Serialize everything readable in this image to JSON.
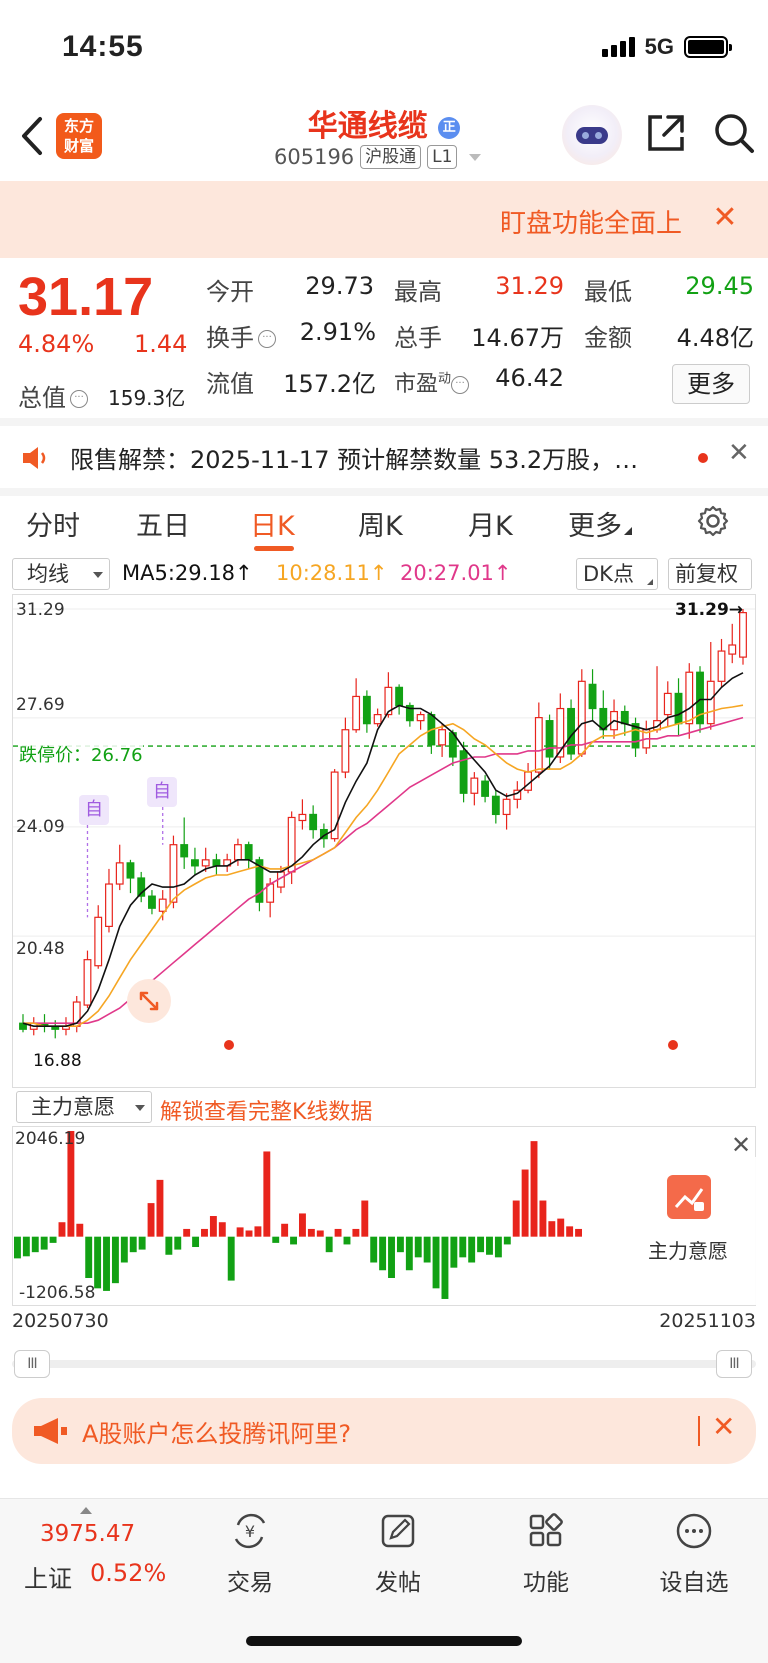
{
  "status_bar": {
    "time": "14:55",
    "network": "5G"
  },
  "nav": {
    "logo_text": "东方财富",
    "stock_name": "华通线缆",
    "stock_code": "605196",
    "tag_connect": "沪股通",
    "tag_level": "L1"
  },
  "banner": {
    "text": "盯盘功能全面上",
    "close": "✕"
  },
  "quote": {
    "price": "31.17",
    "change_pct": "4.84%",
    "change": "1.44",
    "market_cap_label": "总值",
    "market_cap_value": "159.3亿",
    "open_label": "今开",
    "open": "29.73",
    "high_label": "最高",
    "high": "31.29",
    "low_label": "最低",
    "low": "29.45",
    "turnover_label": "换手",
    "turnover": "2.91%",
    "volume_label": "总手",
    "volume": "14.67万",
    "amount_label": "金额",
    "amount": "4.48亿",
    "float_cap_label": "流值",
    "float_cap": "157.2亿",
    "pe_label": "市盈",
    "pe_sup": "动",
    "pe": "46.42",
    "more_label": "更多"
  },
  "notice": {
    "text": "限售解禁：2025-11-17 预计解禁数量 53.2万股，…"
  },
  "tabs": [
    "分时",
    "五日",
    "日K",
    "周K",
    "月K",
    "更多"
  ],
  "active_tab": "日K",
  "ma_row": {
    "dropdown": "均线",
    "ma5": "MA5:29.18↑",
    "ma10": "10:28.11↑",
    "ma20": "20:27.01↑",
    "dk_button": "DK点",
    "adjust_button": "前复权"
  },
  "colors": {
    "up": "#e8241c",
    "down": "#12a114",
    "ma5": "#111111",
    "ma10": "#f6a623",
    "ma20": "#e0388a",
    "accent": "#f05a24"
  },
  "chart_data": [
    {
      "type": "candlestick",
      "y_ticks": [
        "31.29",
        "27.69",
        "24.09",
        "20.48"
      ],
      "ylim": [
        16.88,
        31.29
      ],
      "limit_down_label": "跌停价：",
      "limit_down_value": "26.76",
      "high_marker": "31.29→",
      "low_marker": "16.88",
      "event_markers": [
        "自",
        "自"
      ],
      "candles": [
        [
          17.6,
          17.4,
          17.9,
          17.3
        ],
        [
          17.4,
          17.6,
          17.8,
          17.2
        ],
        [
          17.6,
          17.5,
          17.9,
          17.3
        ],
        [
          17.5,
          17.4,
          17.7,
          17.1
        ],
        [
          17.4,
          17.5,
          17.8,
          17.2
        ],
        [
          17.5,
          18.3,
          18.5,
          17.3
        ],
        [
          18.2,
          19.7,
          20.0,
          18.1
        ],
        [
          19.5,
          21.1,
          21.5,
          19.4
        ],
        [
          20.8,
          22.2,
          22.7,
          20.6
        ],
        [
          22.2,
          22.9,
          23.5,
          22.0
        ],
        [
          22.9,
          22.4,
          23.0,
          21.9
        ],
        [
          22.4,
          21.8,
          22.6,
          21.6
        ],
        [
          21.8,
          21.4,
          22.0,
          21.2
        ],
        [
          21.3,
          21.7,
          22.0,
          21.0
        ],
        [
          21.6,
          23.5,
          23.8,
          21.4
        ],
        [
          23.5,
          23.1,
          24.4,
          22.7
        ],
        [
          23.0,
          22.8,
          23.4,
          22.5
        ],
        [
          22.8,
          23.0,
          23.4,
          22.6
        ],
        [
          23.0,
          22.8,
          23.2,
          22.5
        ],
        [
          22.8,
          23.0,
          23.2,
          22.6
        ],
        [
          23.0,
          23.5,
          23.7,
          22.8
        ],
        [
          23.5,
          23.0,
          23.6,
          22.7
        ],
        [
          23.0,
          21.6,
          23.1,
          21.3
        ],
        [
          21.6,
          22.2,
          22.4,
          21.1
        ],
        [
          22.1,
          22.6,
          22.8,
          21.9
        ],
        [
          22.6,
          24.4,
          24.6,
          22.2
        ],
        [
          24.3,
          24.5,
          25.0,
          24.0
        ],
        [
          24.5,
          24.0,
          24.8,
          23.7
        ],
        [
          24.0,
          23.7,
          24.2,
          23.4
        ],
        [
          23.7,
          25.9,
          26.0,
          23.6
        ],
        [
          25.9,
          27.3,
          27.7,
          25.7
        ],
        [
          27.3,
          28.4,
          29.0,
          27.2
        ],
        [
          28.4,
          27.5,
          28.6,
          27.2
        ],
        [
          27.5,
          27.8,
          28.0,
          27.4
        ],
        [
          27.8,
          28.7,
          29.2,
          27.7
        ],
        [
          28.7,
          28.1,
          28.8,
          27.8
        ],
        [
          28.1,
          27.6,
          28.2,
          27.4
        ],
        [
          27.6,
          27.8,
          27.9,
          27.3
        ],
        [
          27.8,
          26.8,
          27.9,
          26.5
        ],
        [
          26.8,
          27.3,
          27.5,
          26.4
        ],
        [
          27.2,
          26.4,
          27.3,
          26.1
        ],
        [
          26.6,
          25.2,
          26.9,
          24.9
        ],
        [
          25.2,
          25.7,
          25.9,
          24.8
        ],
        [
          25.6,
          25.1,
          25.8,
          24.9
        ],
        [
          25.1,
          24.5,
          25.3,
          24.2
        ],
        [
          24.5,
          25.0,
          25.2,
          24.0
        ],
        [
          25.0,
          25.3,
          25.6,
          24.7
        ],
        [
          25.3,
          25.9,
          26.2,
          25.2
        ],
        [
          25.9,
          27.7,
          28.2,
          25.7
        ],
        [
          27.6,
          26.4,
          27.8,
          26.0
        ],
        [
          26.4,
          28.0,
          28.5,
          26.2
        ],
        [
          28.0,
          26.5,
          28.3,
          26.3
        ],
        [
          26.5,
          28.9,
          29.3,
          26.4
        ],
        [
          28.8,
          28.0,
          29.3,
          27.6
        ],
        [
          28.0,
          27.3,
          28.6,
          27.0
        ],
        [
          27.3,
          27.9,
          28.3,
          27.0
        ],
        [
          27.9,
          27.5,
          28.1,
          27.1
        ],
        [
          27.5,
          26.7,
          27.7,
          26.4
        ],
        [
          26.7,
          27.3,
          27.6,
          26.5
        ],
        [
          27.3,
          27.6,
          29.4,
          27.2
        ],
        [
          27.8,
          28.5,
          28.9,
          27.4
        ],
        [
          28.5,
          27.5,
          29.0,
          27.1
        ],
        [
          27.5,
          29.2,
          29.5,
          27.0
        ],
        [
          29.2,
          27.5,
          29.4,
          27.2
        ],
        [
          27.5,
          28.9,
          30.2,
          27.3
        ],
        [
          28.9,
          29.9,
          30.3,
          28.7
        ],
        [
          29.8,
          30.1,
          30.8,
          29.5
        ],
        [
          29.7,
          31.17,
          31.29,
          29.45
        ]
      ],
      "ma5": [
        17.6,
        17.5,
        17.5,
        17.5,
        17.5,
        17.6,
        18.0,
        18.7,
        19.7,
        20.8,
        21.5,
        21.9,
        22.2,
        22.1,
        22.1,
        22.2,
        22.5,
        22.7,
        22.8,
        22.8,
        23.0,
        23.0,
        22.8,
        22.6,
        22.6,
        22.8,
        23.1,
        23.5,
        23.8,
        24.0,
        24.9,
        25.6,
        26.2,
        27.3,
        27.9,
        28.1,
        28.0,
        28.0,
        27.8,
        27.5,
        27.2,
        26.7,
        26.3,
        25.9,
        25.3,
        25.1,
        25.2,
        25.5,
        25.8,
        26.1,
        26.6,
        27.1,
        27.5,
        27.6,
        27.3,
        27.6,
        27.5,
        27.4,
        27.3,
        27.4,
        27.7,
        27.8,
        28.0,
        28.3,
        28.3,
        28.7,
        29.0,
        29.18
      ],
      "ma10": [
        17.6,
        17.6,
        17.5,
        17.5,
        17.5,
        17.5,
        17.7,
        18.0,
        18.5,
        19.1,
        19.7,
        20.2,
        20.7,
        21.2,
        21.7,
        22.0,
        22.2,
        22.4,
        22.5,
        22.5,
        22.6,
        22.7,
        22.8,
        22.7,
        22.7,
        22.8,
        22.9,
        23.0,
        23.2,
        23.4,
        23.9,
        24.4,
        24.8,
        25.3,
        25.9,
        26.5,
        26.8,
        27.1,
        27.3,
        27.4,
        27.5,
        27.3,
        27.0,
        26.8,
        26.5,
        26.2,
        26.0,
        25.9,
        26.0,
        26.0,
        26.0,
        26.2,
        26.5,
        26.9,
        27.1,
        27.1,
        27.2,
        27.3,
        27.2,
        27.3,
        27.4,
        27.5,
        27.6,
        27.8,
        27.9,
        28.0,
        28.05,
        28.11
      ],
      "ma20": [
        17.6,
        17.6,
        17.6,
        17.6,
        17.6,
        17.6,
        17.6,
        17.7,
        17.9,
        18.1,
        18.4,
        18.7,
        19.0,
        19.3,
        19.6,
        19.9,
        20.2,
        20.5,
        20.8,
        21.1,
        21.4,
        21.7,
        21.9,
        22.2,
        22.4,
        22.6,
        22.8,
        23.0,
        23.2,
        23.4,
        23.7,
        24.0,
        24.2,
        24.5,
        24.8,
        25.1,
        25.4,
        25.6,
        25.8,
        26.0,
        26.2,
        26.3,
        26.4,
        26.4,
        26.5,
        26.5,
        26.5,
        26.6,
        26.6,
        26.7,
        26.7,
        26.8,
        26.8,
        26.9,
        26.9,
        26.9,
        26.9,
        26.9,
        27.0,
        27.0,
        27.1,
        27.1,
        27.2,
        27.3,
        27.4,
        27.5,
        27.6,
        27.7
      ]
    },
    {
      "type": "bar",
      "title": "主力意愿",
      "y_ticks": [
        "2046.19",
        "-1206.58"
      ],
      "ylim": [
        -1206.58,
        2046.19
      ],
      "x_start": "20250730",
      "x_end": "20251103",
      "values": [
        -420,
        -380,
        -300,
        -250,
        -120,
        280,
        2046,
        250,
        -800,
        -1000,
        -1050,
        -900,
        -500,
        -300,
        -250,
        650,
        1100,
        -350,
        -250,
        150,
        -200,
        150,
        400,
        280,
        -850,
        180,
        120,
        200,
        1650,
        -120,
        250,
        -150,
        450,
        150,
        120,
        -300,
        150,
        -150,
        150,
        700,
        -500,
        -650,
        -800,
        -300,
        -650,
        -400,
        -500,
        -1000,
        -1206,
        -600,
        -400,
        -500,
        -300,
        -350,
        -400,
        -150,
        700,
        1300,
        1850,
        700,
        300,
        350,
        200,
        150
      ]
    }
  ],
  "unlock_text": "解锁查看完整K线数据",
  "sub_overlay_label": "主力意愿",
  "ad": {
    "text": "A股账户怎么投腾讯阿里?"
  },
  "tabbar": {
    "index_value": "3975.47",
    "index_name": "上证",
    "index_pct": "0.52%",
    "items": [
      "交易",
      "发帖",
      "功能",
      "设自选"
    ]
  }
}
